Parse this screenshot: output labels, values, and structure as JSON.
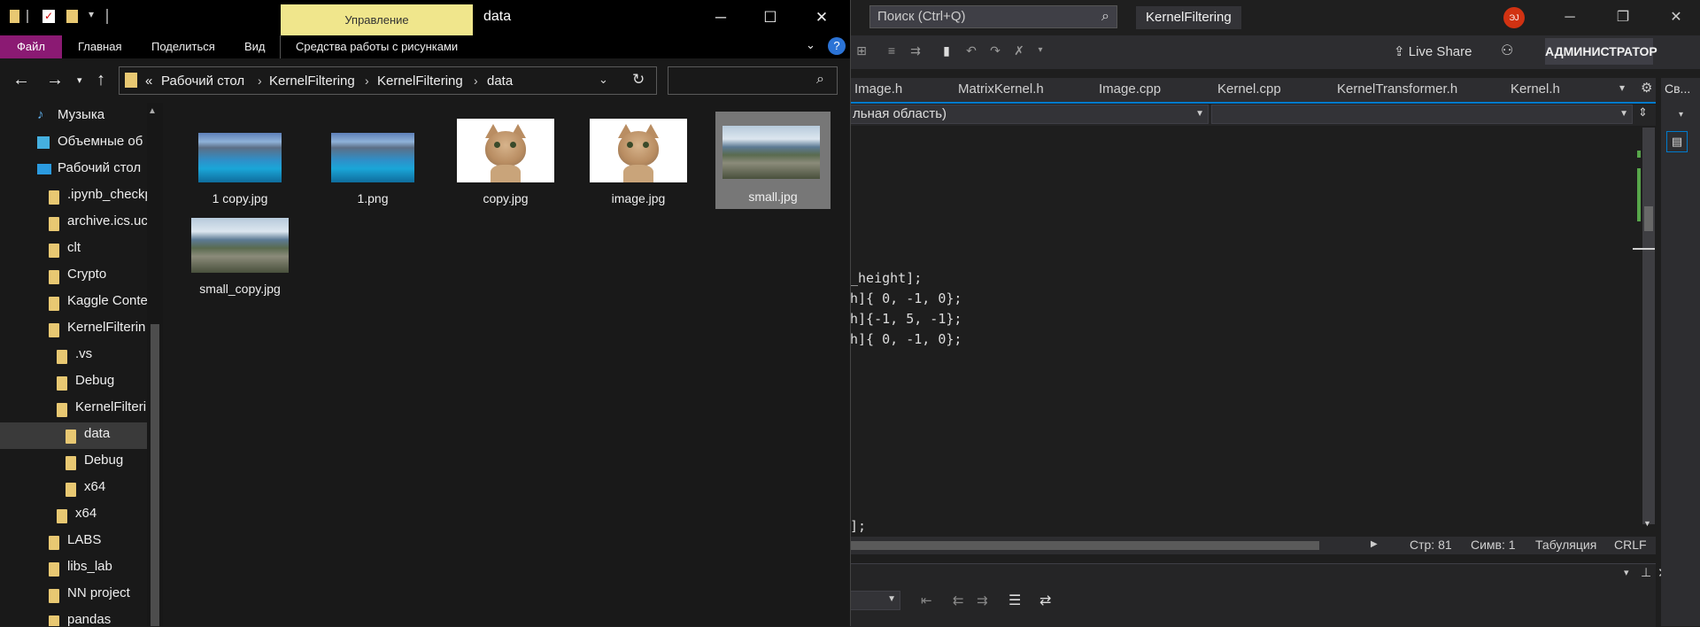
{
  "vs": {
    "search_placeholder": "Поиск (Ctrl+Q)",
    "project_name": "KernelFiltering",
    "avatar_initials": "ЭJ",
    "live_share": "Live Share",
    "admin_label": "АДМИНИСТРАТОР",
    "tabs": [
      "Image.h",
      "MatrixKernel.h",
      "Image.cpp",
      "Kernel.cpp",
      "KernelTransformer.h",
      "Kernel.h"
    ],
    "scope_dropdown": "льная область)",
    "code_lines": [
      "_height];",
      "h]{ 0, -1, 0};",
      "h]{-1, 5, -1};",
      "h]{ 0, -1, 0};",
      "];"
    ],
    "status": {
      "line": "Стр: 81",
      "col": "Симв: 1",
      "tabs": "Табуляция",
      "eol": "CRLF"
    },
    "right_panel_tab": "Св..."
  },
  "explorer": {
    "ribbon_manage": "Управление",
    "ribbon_pictures": "Средства работы с рисунками",
    "window_title": "data",
    "ribbon_tabs": [
      "Файл",
      "Главная",
      "Поделиться",
      "Вид"
    ],
    "breadcrumb_prefix": "«",
    "breadcrumb": [
      "Рабочий стол",
      "KernelFiltering",
      "KernelFiltering",
      "data"
    ],
    "search_placeholder": "",
    "tree": [
      {
        "label": "Музыка",
        "icon": "music-icon"
      },
      {
        "label": "Объемные об",
        "icon": "3d-objects-icon"
      },
      {
        "label": "Рабочий стол",
        "icon": "desktop-icon"
      },
      {
        "label": ".ipynb_checkp",
        "icon": "folder-icon"
      },
      {
        "label": "archive.ics.uci",
        "icon": "folder-icon"
      },
      {
        "label": "clt",
        "icon": "folder-icon"
      },
      {
        "label": "Crypto",
        "icon": "folder-icon"
      },
      {
        "label": "Kaggle Conte",
        "icon": "folder-icon"
      },
      {
        "label": "KernelFilterin",
        "icon": "folder-icon"
      },
      {
        "label": ".vs",
        "icon": "folder-icon"
      },
      {
        "label": "Debug",
        "icon": "folder-icon"
      },
      {
        "label": "KernelFilteri",
        "icon": "folder-icon"
      },
      {
        "label": "data",
        "icon": "folder-icon"
      },
      {
        "label": "Debug",
        "icon": "folder-icon"
      },
      {
        "label": "x64",
        "icon": "folder-icon"
      },
      {
        "label": "x64",
        "icon": "folder-icon"
      },
      {
        "label": "LABS",
        "icon": "folder-icon"
      },
      {
        "label": "libs_lab",
        "icon": "folder-icon"
      },
      {
        "label": "NN project",
        "icon": "folder-icon"
      },
      {
        "label": "pandas",
        "icon": "folder-icon"
      }
    ],
    "files": [
      {
        "name": "1 copy.jpg",
        "thumb": "lake"
      },
      {
        "name": "1.png",
        "thumb": "lake"
      },
      {
        "name": "copy.jpg",
        "thumb": "cat"
      },
      {
        "name": "image.jpg",
        "thumb": "cat"
      },
      {
        "name": "small.jpg",
        "thumb": "city",
        "selected": true
      },
      {
        "name": "small_copy.jpg",
        "thumb": "city"
      }
    ],
    "colors": {
      "file_tab": "#8b1a73",
      "manage_tab": "#f0e68c",
      "folder": "#e8c872"
    }
  }
}
